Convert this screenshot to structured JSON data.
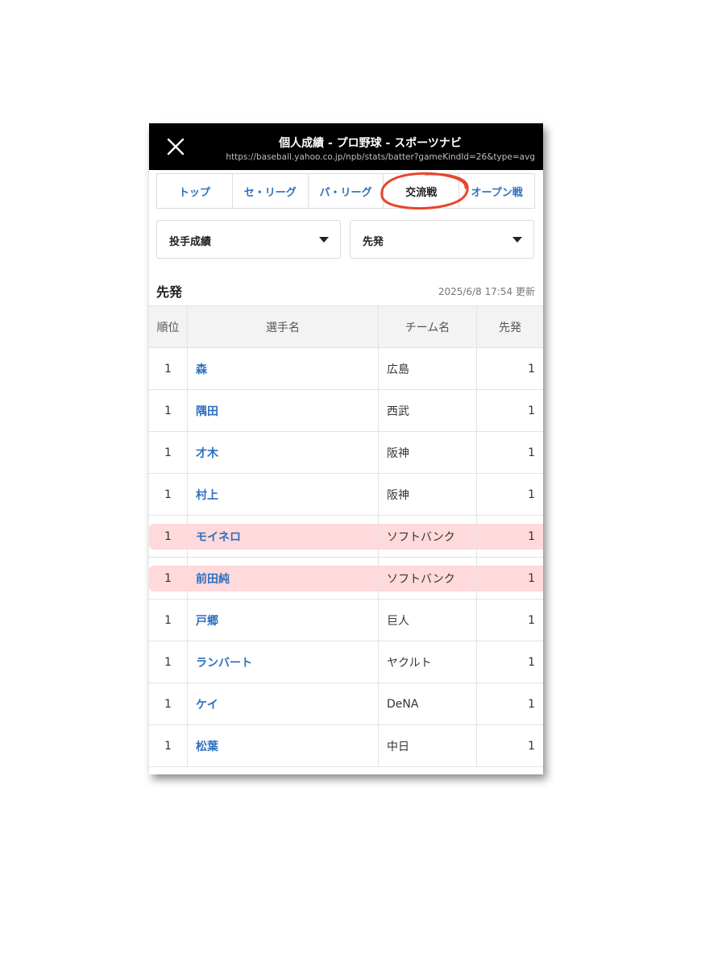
{
  "titlebar": {
    "title": "個人成績 - プロ野球 - スポーツナビ",
    "url": "https://baseball.yahoo.co.jp/npb/stats/batter?gameKindId=26&type=avg"
  },
  "tabs": [
    {
      "label": "トップ"
    },
    {
      "label": "セ・リーグ"
    },
    {
      "label": "パ・リーグ"
    },
    {
      "label": "交流戦"
    },
    {
      "label": "オープン戦"
    }
  ],
  "active_tab": "交流戦",
  "filters": {
    "category": "投手成績",
    "stat": "先発"
  },
  "section": {
    "title": "先発",
    "updated": "2025/6/8 17:54 更新"
  },
  "table": {
    "headers": [
      "順位",
      "選手名",
      "チーム名",
      "先発"
    ],
    "rows": [
      {
        "rank": "1",
        "name": "森",
        "team": "広島",
        "gs": "1"
      },
      {
        "rank": "1",
        "name": "隅田",
        "team": "西武",
        "gs": "1"
      },
      {
        "rank": "1",
        "name": "才木",
        "team": "阪神",
        "gs": "1"
      },
      {
        "rank": "1",
        "name": "村上",
        "team": "阪神",
        "gs": "1"
      },
      {
        "rank": "1",
        "name": "モイネロ",
        "team": "ソフトバンク",
        "gs": "1"
      },
      {
        "rank": "1",
        "name": "前田純",
        "team": "ソフトバンク",
        "gs": "1"
      },
      {
        "rank": "1",
        "name": "戸郷",
        "team": "巨人",
        "gs": "1"
      },
      {
        "rank": "1",
        "name": "ランバート",
        "team": "ヤクルト",
        "gs": "1"
      },
      {
        "rank": "1",
        "name": "ケイ",
        "team": "DeNA",
        "gs": "1"
      },
      {
        "rank": "1",
        "name": "松葉",
        "team": "中日",
        "gs": "1"
      }
    ]
  },
  "highlighted_rows": [
    4,
    5
  ],
  "colors": {
    "link": "#2f6fc0",
    "circle_annotation": "#e8452c",
    "highlight": "#ffaaaf"
  }
}
